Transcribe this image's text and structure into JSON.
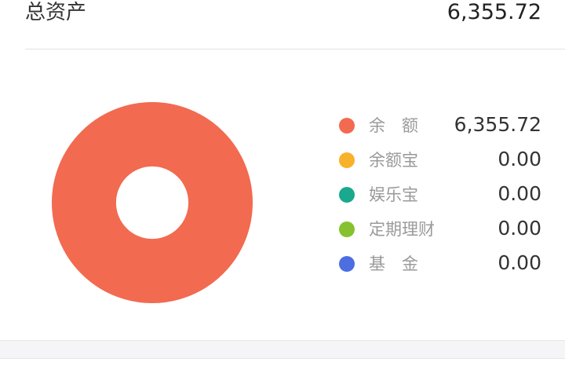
{
  "header": {
    "title": "总资产",
    "total": "6,355.72"
  },
  "chart_data": {
    "type": "pie",
    "categories": [
      "余　额",
      "余额宝",
      "娱乐宝",
      "定期理财",
      "基　金"
    ],
    "values": [
      6355.72,
      0.0,
      0.0,
      0.0,
      0.0
    ],
    "colors": [
      "#f26a50",
      "#f7b22a",
      "#1aa88e",
      "#86c230",
      "#4d6ee0"
    ],
    "hole_ratio": 0.36
  },
  "legend": {
    "items": [
      {
        "label": "余　额",
        "value": "6,355.72",
        "color": "#f26a50"
      },
      {
        "label": "余额宝",
        "value": "0.00",
        "color": "#f7b22a"
      },
      {
        "label": "娱乐宝",
        "value": "0.00",
        "color": "#1aa88e"
      },
      {
        "label": "定期理财",
        "value": "0.00",
        "color": "#86c230"
      },
      {
        "label": "基　金",
        "value": "0.00",
        "color": "#4d6ee0"
      }
    ]
  }
}
